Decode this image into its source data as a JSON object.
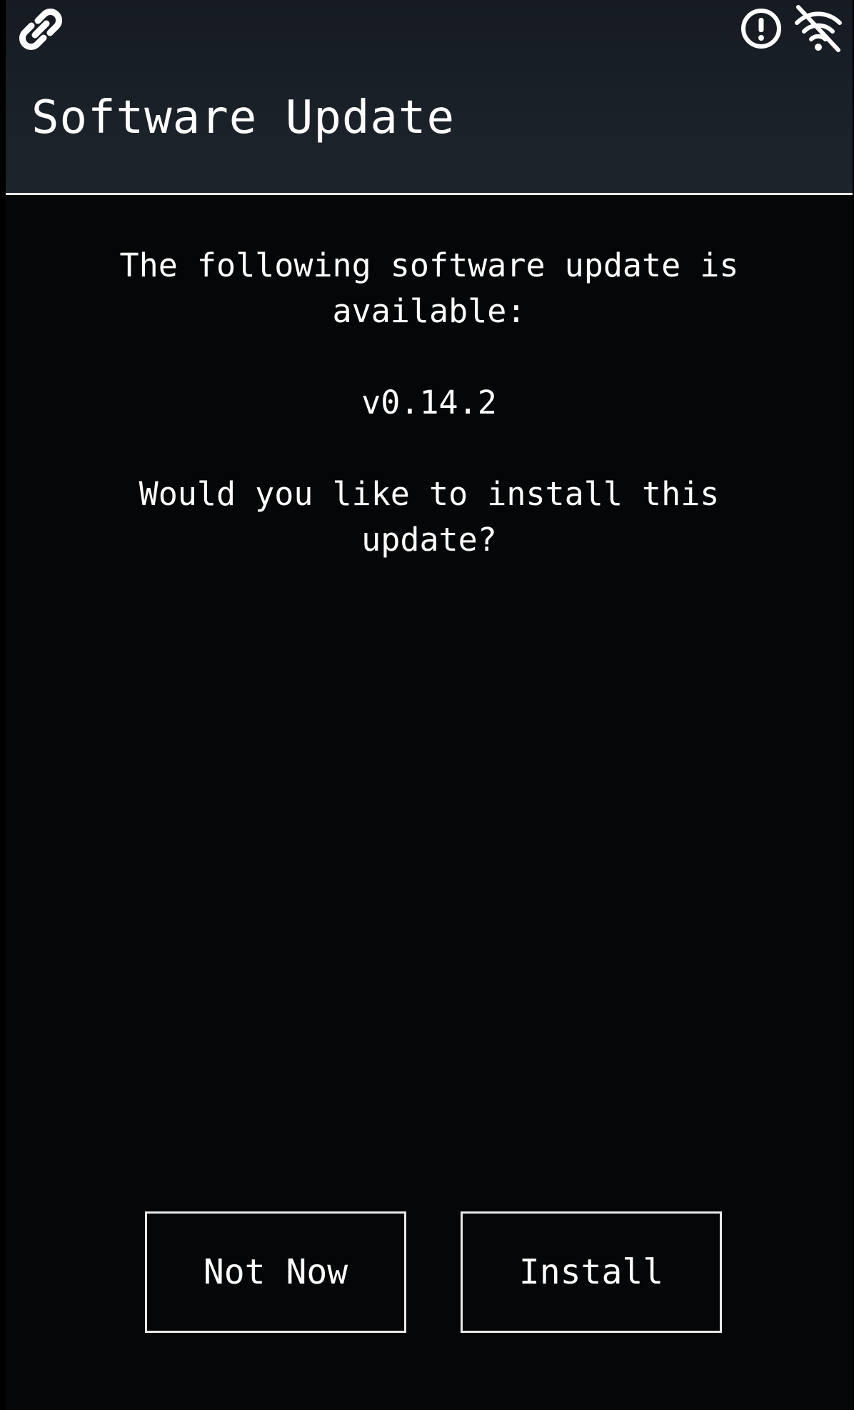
{
  "status_bar": {
    "left_icon": "link-icon",
    "right_icons": [
      "alert-circle-icon",
      "wifi-off-icon"
    ]
  },
  "header": {
    "title": "Software Update"
  },
  "dialog": {
    "message": "The following software update is available:",
    "version": "v0.14.2",
    "question": "Would you like to install this update?"
  },
  "actions": {
    "not_now_label": "Not Now",
    "install_label": "Install"
  },
  "colors": {
    "background": "#050607",
    "header_background": "#1b2129",
    "text": "#ffffff",
    "border": "#e8e8e8"
  }
}
